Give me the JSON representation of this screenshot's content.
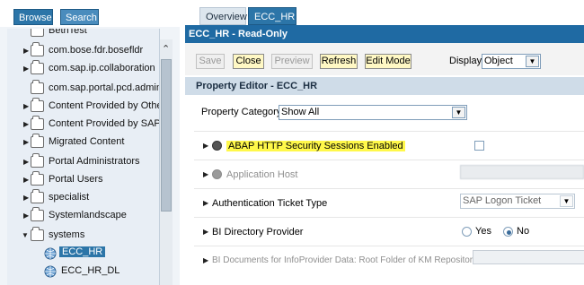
{
  "left_tabs": {
    "browse": "Browse",
    "search": "Search"
  },
  "tree": {
    "items": [
      {
        "label": "BethTest",
        "expandable": false
      },
      {
        "label": "com.bose.fdr.bosefldr",
        "expandable": true
      },
      {
        "label": "com.sap.ip.collaboration",
        "expandable": true
      },
      {
        "label": "com.sap.portal.pcd.admintool",
        "expandable": false
      },
      {
        "label": "Content Provided by Other Ve",
        "expandable": true
      },
      {
        "label": "Content Provided by SAP",
        "expandable": true
      },
      {
        "label": "Migrated Content",
        "expandable": true
      },
      {
        "label": "Portal Administrators",
        "expandable": true
      },
      {
        "label": "Portal Users",
        "expandable": true
      },
      {
        "label": "specialist",
        "expandable": true
      },
      {
        "label": "Systemlandscape",
        "expandable": true
      },
      {
        "label": "systems",
        "expandable": true,
        "expanded": true
      },
      {
        "label": "ECC_HR",
        "selected": true
      },
      {
        "label": "ECC_HR_DL"
      }
    ]
  },
  "right_tabs": {
    "overview": "Overview",
    "ecc_hr": "ECC_HR"
  },
  "title": "ECC_HR - Read-Only",
  "toolbar": {
    "save": "Save",
    "close": "Close",
    "preview": "Preview",
    "refresh": "Refresh",
    "edit_mode": "Edit Mode",
    "display_label": "Display:",
    "display_value": "Object"
  },
  "property_editor": {
    "header": "Property Editor - ECC_HR",
    "category_label": "Property Category:",
    "category_value": "Show All"
  },
  "properties": [
    {
      "label": "ABAP HTTP Security Sessions Enabled",
      "highlighted": true,
      "control": "checkbox"
    },
    {
      "label": "Application Host",
      "dim": true,
      "control": "text",
      "value_hidden": true
    },
    {
      "label": "Authentication Ticket Type",
      "control": "select",
      "value": "SAP Logon Ticket"
    },
    {
      "label": "BI Directory Provider",
      "control": "radio",
      "options": [
        "Yes",
        "No"
      ],
      "selected": "No"
    },
    {
      "label": "BI Documents for InfoProvider Data: Root Folder of KM Repository",
      "dim": true,
      "control": "text"
    }
  ],
  "colors": {
    "tab_blue": "#2c75a8",
    "title_blue": "#1f6aa3",
    "button_yellow": "#fff8c4",
    "highlight_yellow": "#fff84a"
  }
}
